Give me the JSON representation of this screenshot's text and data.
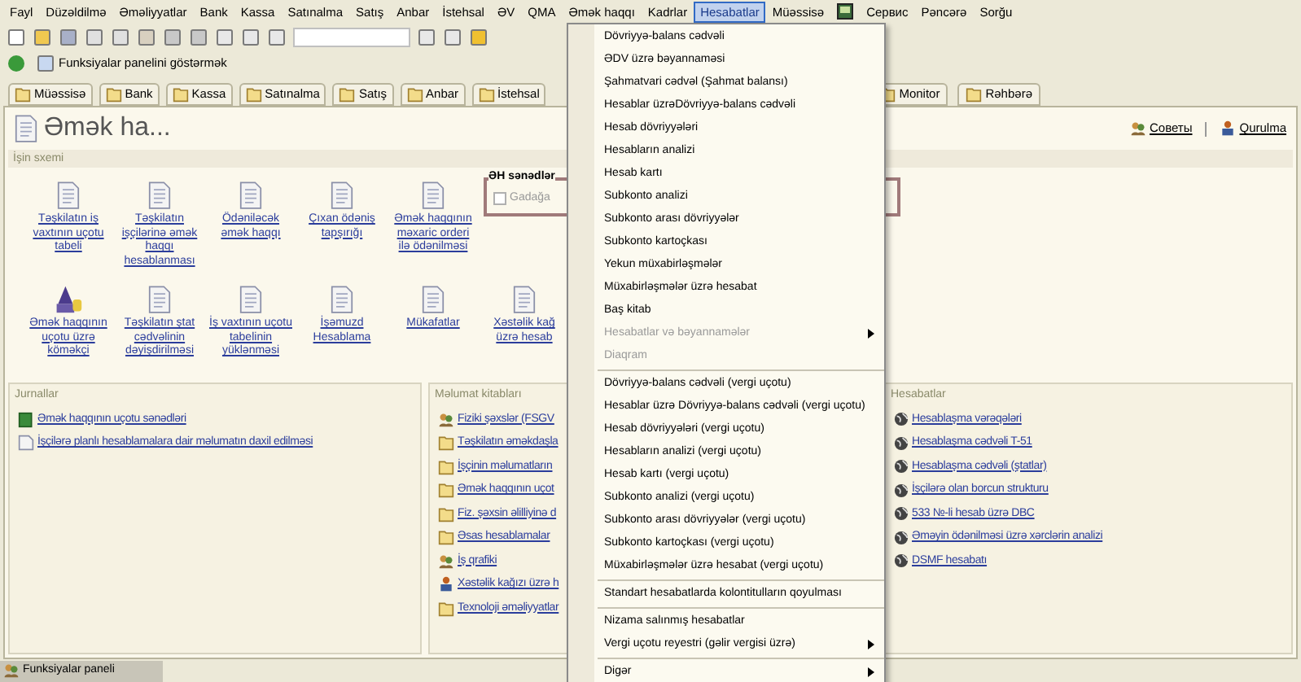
{
  "menubar": [
    {
      "kind": "text",
      "label": "Fayl",
      "selected": false
    },
    {
      "kind": "text",
      "label": "Düzəldilmə",
      "selected": false
    },
    {
      "kind": "text",
      "label": "Əməliyyatlar",
      "selected": false
    },
    {
      "kind": "text",
      "label": "Bank",
      "selected": false
    },
    {
      "kind": "text",
      "label": "Kassa",
      "selected": false
    },
    {
      "kind": "text",
      "label": "Satınalma",
      "selected": false
    },
    {
      "kind": "text",
      "label": "Satış",
      "selected": false
    },
    {
      "kind": "text",
      "label": "Anbar",
      "selected": false
    },
    {
      "kind": "text",
      "label": "İstehsal",
      "selected": false
    },
    {
      "kind": "text",
      "label": "ƏV",
      "selected": false
    },
    {
      "kind": "text",
      "label": "QMA",
      "selected": false
    },
    {
      "kind": "text",
      "label": "Əmək haqqı",
      "selected": false
    },
    {
      "kind": "text",
      "label": "Kadrlar",
      "selected": false
    },
    {
      "kind": "text",
      "label": "Hesabatlar",
      "selected": true
    },
    {
      "kind": "text",
      "label": "Müəssisə",
      "selected": false
    },
    {
      "kind": "icon",
      "selected": false
    },
    {
      "kind": "text",
      "label": "Сервис",
      "selected": false
    },
    {
      "kind": "text",
      "label": "Pəncərə",
      "selected": false
    },
    {
      "kind": "text",
      "label": "Sorğu",
      "selected": false
    }
  ],
  "toolbar2": {
    "label": "Funksiyalar panelini göstərmək"
  },
  "tabs": [
    {
      "label": "Müəssisə"
    },
    {
      "label": "Bank"
    },
    {
      "label": "Kassa"
    },
    {
      "label": "Satınalma"
    },
    {
      "label": "Satış"
    },
    {
      "label": "Anbar"
    },
    {
      "label": "İstehsal"
    }
  ],
  "tabs_right": [
    {
      "label": "Monitor"
    },
    {
      "label": "Rəhbərə"
    }
  ],
  "panel": {
    "title": "Əmək ha...",
    "tips": "Советы",
    "settings": "Qurulma",
    "scheme_title": "İşin sxemi",
    "scheme_rows": [
      [
        {
          "label": "Təşkilatın iş vaxtının uçotu tabeli",
          "kind": "doc"
        },
        {
          "label": "Təşkilatın işçilərinə əmək haqqı hesablanması",
          "kind": "doc"
        },
        {
          "label": "Ödəniləcək əmək haqqı",
          "kind": "doc"
        },
        {
          "label": "Çıxan ödəniş tapşırığı",
          "kind": "doc"
        },
        {
          "label": "Əmək haqqının məxaric orderi ilə ödənilməsi",
          "kind": "doc"
        }
      ],
      [
        {
          "label": "Əmək haqqının uçotu üzrə köməkçi",
          "kind": "wizard"
        },
        {
          "label": "Təşkilatın ştat cədvəlinin dəyişdirilməsi",
          "kind": "doc"
        },
        {
          "label": "İş vaxtının uçotu tabelinin yüklənməsi",
          "kind": "doc"
        },
        {
          "label": "İşəmuzd Hesablama",
          "kind": "doc"
        },
        {
          "label": "Mükafatlar",
          "kind": "doc"
        },
        {
          "label": "Xəstəlik kağ üzrə hesab",
          "kind": "doc"
        }
      ]
    ],
    "docs_box": {
      "title": "ƏH sənədlər",
      "option": "Gadağa",
      "checked": false
    },
    "journals": {
      "title": "Jurnallar",
      "items": [
        {
          "label": "Əmək haqqının uçotu sənədləri",
          "kind": "journal"
        },
        {
          "label": "İşçilərə planlı hesablamalara dair məlumatın daxil edilməsi",
          "kind": "doc"
        }
      ]
    },
    "catalogs": {
      "title": "Məlumat kitabları",
      "items": [
        {
          "label": "Fiziki şəxslər (FSGV",
          "kind": "people"
        },
        {
          "label": "Təşkilatın əməkdaşla",
          "kind": "folder"
        },
        {
          "label": "İşçinin məlumatların",
          "kind": "folder"
        },
        {
          "label": "Əmək haqqının uçot",
          "kind": "folder"
        },
        {
          "label": "Fiz. şəxsin əlilliyinə d",
          "kind": "folder"
        },
        {
          "label": "Əsas hesablamalar",
          "kind": "folder"
        },
        {
          "label": "İş qrafiki",
          "kind": "people"
        },
        {
          "label": "Xəstəlik kağızı üzrə h",
          "kind": "sick"
        },
        {
          "label": "Texnoloji əməliyyatlar",
          "kind": "folder"
        }
      ]
    },
    "reports": {
      "title": "Hesabatlar",
      "items": [
        {
          "label": "Hesablaşma vərəqələri"
        },
        {
          "label": "Hesablaşma cədvəli T-51"
        },
        {
          "label": "Hesablaşma cədvəli (ştatlar)"
        },
        {
          "label": "İşçilərə olan borcun strukturu"
        },
        {
          "label": "533 №-li hesab üzrə DBC"
        },
        {
          "label": "Əməyin ödənilməsi üzrə xərclərin analizi"
        },
        {
          "label": "DSMF hesabatı"
        }
      ]
    }
  },
  "menu": [
    {
      "kind": "item",
      "label": "Dövriyyə-balans cədvəli",
      "disabled": false
    },
    {
      "kind": "item",
      "label": "ƏDV üzrə bəyannaməsi",
      "disabled": false
    },
    {
      "kind": "item",
      "label": "Şahmatvari cədvəl (Şahmat balansı)",
      "disabled": false
    },
    {
      "kind": "item",
      "label": "Hesablar üzrəDövriyyə-balans cədvəli",
      "disabled": false
    },
    {
      "kind": "item",
      "label": "Hesab dövriyyələri",
      "disabled": false
    },
    {
      "kind": "item",
      "label": "Hesabların analizi",
      "disabled": false
    },
    {
      "kind": "item",
      "label": "Hesab kartı",
      "disabled": false
    },
    {
      "kind": "item",
      "label": "Subkonto analizi",
      "disabled": false
    },
    {
      "kind": "item",
      "label": "Subkonto arası dövriyyələr",
      "disabled": false
    },
    {
      "kind": "item",
      "label": "Subkonto kartoçkası",
      "disabled": false
    },
    {
      "kind": "item",
      "label": "Yekun müxabirləşmələr",
      "disabled": false
    },
    {
      "kind": "item",
      "label": "Müxabirləşmələr üzrə hesabat",
      "disabled": false
    },
    {
      "kind": "item",
      "label": "Baş kitab",
      "disabled": false
    },
    {
      "kind": "submenu",
      "label": "Hesabatlar və bəyannamələr",
      "disabled": true
    },
    {
      "kind": "item",
      "label": "Diaqram",
      "disabled": true
    },
    {
      "kind": "separator"
    },
    {
      "kind": "item",
      "label": "Dövriyyə-balans cədvəli (vergi uçotu)",
      "disabled": false
    },
    {
      "kind": "item",
      "label": "Hesablar üzrə Dövriyyə-balans cədvəli (vergi uçotu)",
      "disabled": false
    },
    {
      "kind": "item",
      "label": "Hesab dövriyyələri (vergi uçotu)",
      "disabled": false
    },
    {
      "kind": "item",
      "label": "Hesabların analizi (vergi uçotu)",
      "disabled": false
    },
    {
      "kind": "item",
      "label": "Hesab kartı (vergi uçotu)",
      "disabled": false
    },
    {
      "kind": "item",
      "label": "Subkonto analizi (vergi uçotu)",
      "disabled": false
    },
    {
      "kind": "item",
      "label": "Subkonto arası dövriyyələr (vergi uçotu)",
      "disabled": false
    },
    {
      "kind": "item",
      "label": "Subkonto kartoçkası (vergi uçotu)",
      "disabled": false
    },
    {
      "kind": "item",
      "label": "Müxabirləşmələr üzrə hesabat (vergi uçotu)",
      "disabled": false
    },
    {
      "kind": "separator"
    },
    {
      "kind": "item",
      "label": "Standart hesabatlarda kolontitulların qoyulması",
      "disabled": false
    },
    {
      "kind": "separator"
    },
    {
      "kind": "item",
      "label": "Nizama salınmış hesabatlar",
      "disabled": false
    },
    {
      "kind": "submenu",
      "label": "Vergi uçotu reyestri (gəlir vergisi üzrə)",
      "disabled": false
    },
    {
      "kind": "separator"
    },
    {
      "kind": "submenu",
      "label": "Digər",
      "disabled": false
    }
  ],
  "status_bar": {
    "label": "Funksiyalar paneli"
  }
}
